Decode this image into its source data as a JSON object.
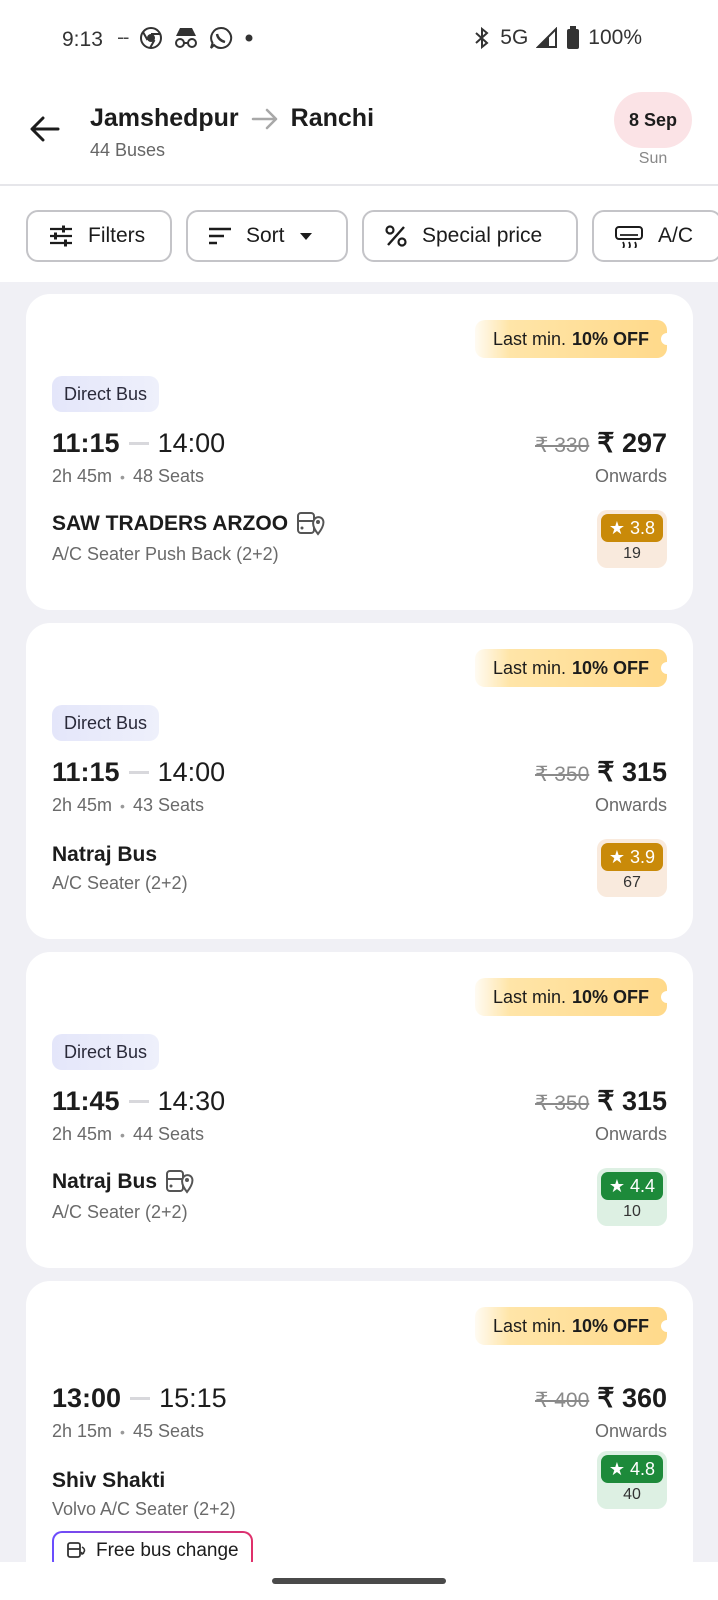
{
  "status_bar": {
    "time": "9:13",
    "network": "5G",
    "battery": "100%"
  },
  "header": {
    "origin": "Jamshedpur",
    "destination": "Ranchi",
    "buses_count": "44 Buses",
    "date": "8 Sep",
    "day": "Sun"
  },
  "filters": [
    {
      "label": "Filters",
      "icon": "sliders-icon"
    },
    {
      "label": "Sort",
      "icon": "sort-icon"
    },
    {
      "label": "Special price",
      "icon": "percent-icon"
    },
    {
      "label": "A/C",
      "icon": "ac-icon"
    }
  ],
  "buses": [
    {
      "offer_prefix": "Last min.",
      "offer_bold": "10% OFF",
      "tag": "Direct Bus",
      "departure": "11:15",
      "arrival": "14:00",
      "duration": "2h 45m",
      "seats": "48 Seats",
      "old_price": "₹ 330",
      "price": "₹ 297",
      "price_note": "Onwards",
      "operator": "SAW TRADERS ARZOO",
      "live_tracking": true,
      "bus_type": "A/C Seater Push Back (2+2)",
      "rating": "3.8",
      "rating_count": "19",
      "rating_color": "#c98a09"
    },
    {
      "offer_prefix": "Last min.",
      "offer_bold": "10% OFF",
      "tag": "Direct Bus",
      "departure": "11:15",
      "arrival": "14:00",
      "duration": "2h 45m",
      "seats": "43 Seats",
      "old_price": "₹ 350",
      "price": "₹ 315",
      "price_note": "Onwards",
      "operator": "Natraj Bus",
      "live_tracking": false,
      "bus_type": "A/C Seater (2+2)",
      "rating": "3.9",
      "rating_count": "67",
      "rating_color": "#c98a09"
    },
    {
      "offer_prefix": "Last min.",
      "offer_bold": "10% OFF",
      "tag": "Direct Bus",
      "departure": "11:45",
      "arrival": "14:30",
      "duration": "2h 45m",
      "seats": "44 Seats",
      "old_price": "₹ 350",
      "price": "₹ 315",
      "price_note": "Onwards",
      "operator": "Natraj Bus",
      "live_tracking": true,
      "bus_type": "A/C Seater (2+2)",
      "rating": "4.4",
      "rating_count": "10",
      "rating_color": "#1d8a3a"
    },
    {
      "offer_prefix": "Last min.",
      "offer_bold": "10% OFF",
      "tag": "",
      "departure": "13:00",
      "arrival": "15:15",
      "duration": "2h 15m",
      "seats": "45 Seats",
      "old_price": "₹ 400",
      "price": "₹ 360",
      "price_note": "Onwards",
      "operator": "Shiv Shakti",
      "live_tracking": false,
      "bus_type": "Volvo A/C Seater (2+2)",
      "rating": "4.8",
      "rating_count": "40",
      "rating_color": "#1d8a3a",
      "feature_badge": "Free bus change"
    }
  ]
}
